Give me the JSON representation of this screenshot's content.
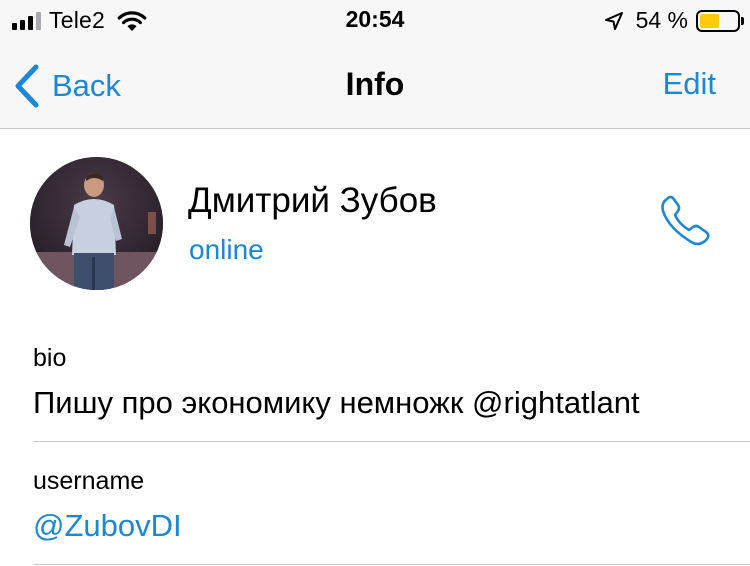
{
  "status_bar": {
    "carrier": "Tele2",
    "time": "20:54",
    "battery_percent": "54 %",
    "battery_level": 0.54,
    "signal_bars": 4,
    "signal_active": 3
  },
  "nav": {
    "back_label": "Back",
    "title": "Info",
    "edit_label": "Edit"
  },
  "profile": {
    "name": "Дмитрий Зубов",
    "status": "online"
  },
  "rows": {
    "bio_label": "bio",
    "bio_value": "Пишу про экономику немножк @rightatlant",
    "username_label": "username",
    "username_value": "@ZubovDI"
  },
  "colors": {
    "accent": "#1a87d7",
    "bar_background": "#f7f7f8",
    "separator": "#c8c7cc",
    "battery_fill": "#fecc0a"
  }
}
